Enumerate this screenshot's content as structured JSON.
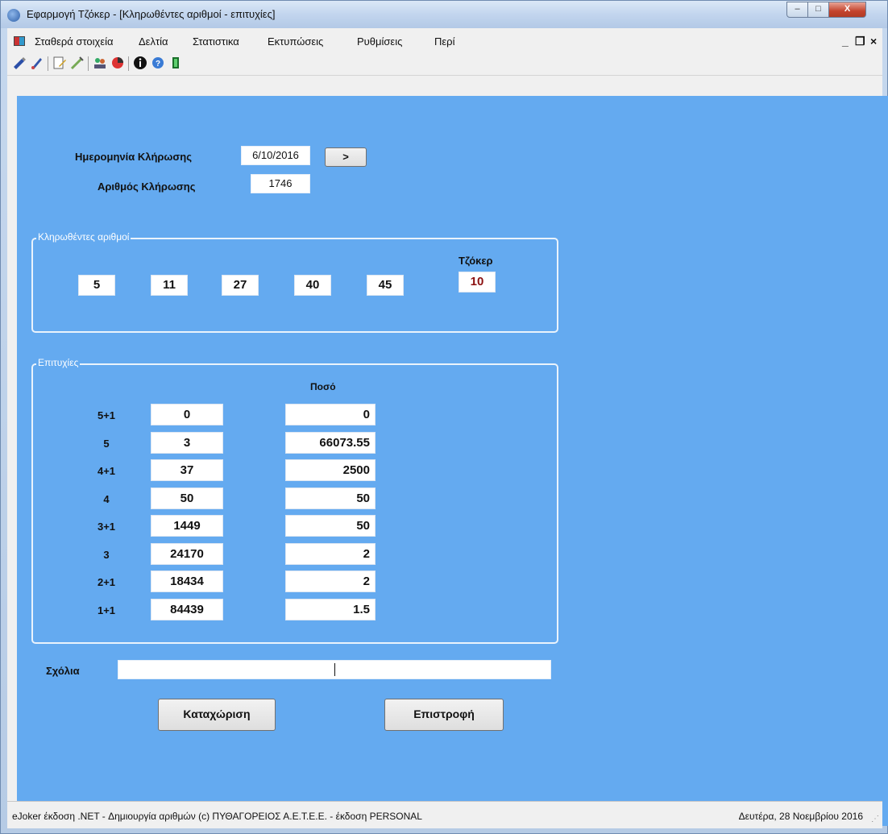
{
  "window": {
    "title": "Εφαρμογή Τζόκερ - [Κληρωθέντες αριθμοί - επιτυχίες]",
    "min_glyph": "–",
    "max_glyph": "□",
    "close_glyph": "X"
  },
  "menu": {
    "items": [
      "Σταθερά στοιχεία",
      "Δελτία",
      "Στατιστικα",
      "Εκτυπώσεις",
      "Ρυθμίσεις",
      "Περί"
    ],
    "mdi_min": "_",
    "mdi_restore": "❐",
    "mdi_close": "×"
  },
  "toolbar": {
    "icons": [
      "pen-icon",
      "pencil-icon",
      "edit-icon",
      "brush-icon",
      "people-icon",
      "chart-icon",
      "info-icon",
      "help-icon",
      "exit-icon"
    ]
  },
  "draw": {
    "date_label": "Ημερομηνία Κλήρωσης",
    "date_value": "6/10/2016",
    "next_button": ">",
    "number_label": "Αριθμός Κλήρωσης",
    "number_value": "1746"
  },
  "drawn_numbers": {
    "title": "Κληρωθέντες αριθμοί",
    "numbers": [
      "5",
      "11",
      "27",
      "40",
      "45"
    ],
    "joker_label": "Τζόκερ",
    "joker_value": "10",
    "joker_color": "#8b1010"
  },
  "wins": {
    "title": "Επιτυχίες",
    "amount_header": "Ποσό",
    "rows": [
      {
        "category": "5+1",
        "winners": "0",
        "amount": "0"
      },
      {
        "category": "5",
        "winners": "3",
        "amount": "66073.55"
      },
      {
        "category": "4+1",
        "winners": "37",
        "amount": "2500"
      },
      {
        "category": "4",
        "winners": "50",
        "amount": "50"
      },
      {
        "category": "3+1",
        "winners": "1449",
        "amount": "50"
      },
      {
        "category": "3",
        "winners": "24170",
        "amount": "2"
      },
      {
        "category": "2+1",
        "winners": "18434",
        "amount": "2"
      },
      {
        "category": "1+1",
        "winners": "84439",
        "amount": "1.5"
      }
    ]
  },
  "comments": {
    "label": "Σχόλια",
    "value": ""
  },
  "buttons": {
    "submit": "Καταχώριση",
    "back": "Επιστροφή"
  },
  "status": {
    "left": "eJoker έκδοση .NET  - Δημιουργία αριθμών  (c) ΠΥΘΑΓΟΡΕΙΟΣ  Α.Ε.Τ.Ε.Ε.  - έκδοση PERSONAL",
    "right": "Δευτέρα, 28 Νοεμβρίου 2016"
  },
  "colors": {
    "form_background": "#64aaf0",
    "close_button": "#c4432d"
  }
}
